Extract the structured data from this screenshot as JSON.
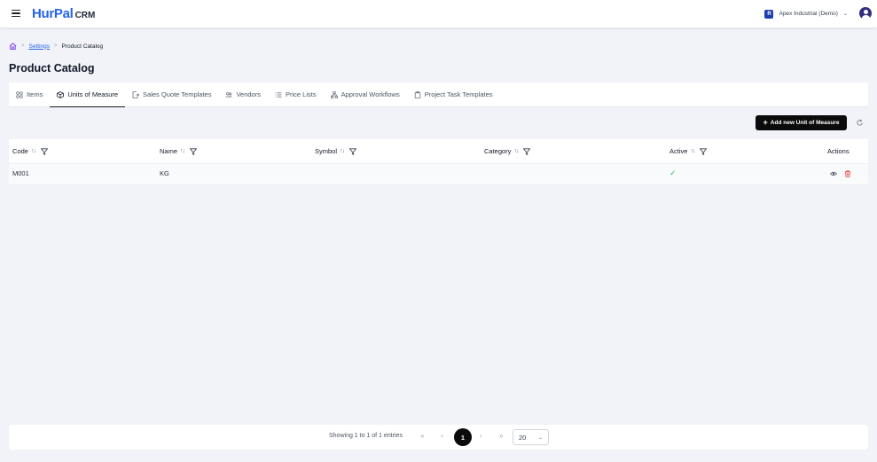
{
  "app": {
    "logo_main": "HurPal",
    "logo_sub": "CRM"
  },
  "org": {
    "badge": "R",
    "name": "Apex Industrial (Demo)",
    "chevron": "⌄"
  },
  "breadcrumb": {
    "settings": "Settings",
    "current": "Product Catalog",
    "sep": ">"
  },
  "page": {
    "title": "Product Catalog"
  },
  "tabs": [
    {
      "label": "Items",
      "icon": "grid-icon"
    },
    {
      "label": "Units of Measure",
      "icon": "box-icon"
    },
    {
      "label": "Sales Quote Templates",
      "icon": "file-export-icon"
    },
    {
      "label": "Vendors",
      "icon": "users-icon"
    },
    {
      "label": "Price Lists",
      "icon": "list-icon"
    },
    {
      "label": "Approval Workflows",
      "icon": "workflow-icon"
    },
    {
      "label": "Project Task Templates",
      "icon": "clipboard-icon"
    }
  ],
  "toolbar": {
    "add_label": "Add new Unit of Measure"
  },
  "table": {
    "headers": {
      "code": "Code",
      "name": "Name",
      "symbol": "Symbol",
      "category": "Category",
      "active": "Active",
      "actions": "Actions"
    },
    "rows": [
      {
        "code": "M001",
        "name": "KG",
        "symbol": "",
        "category": "",
        "active": "✓"
      }
    ]
  },
  "pagination": {
    "summary": "Showing 1 to 1 of 1 entries",
    "first": "«",
    "prev": "‹",
    "current": "1",
    "next": "›",
    "last": "»",
    "page_size": "20"
  },
  "colors": {
    "brand": "#2563eb",
    "primary_button": "#0b0b0b",
    "success": "#22c55e",
    "danger": "#ef4444"
  }
}
